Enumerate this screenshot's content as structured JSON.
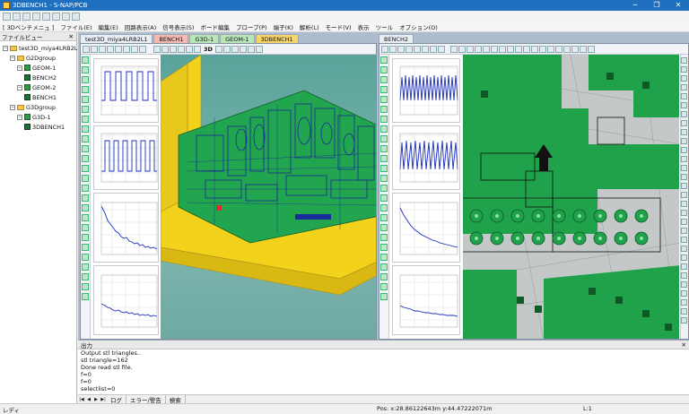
{
  "window": {
    "title": "3DBENCH1 - S-NAP/PCB",
    "minimize": "─",
    "maximize": "❐",
    "close": "✕"
  },
  "menubar": {
    "items": [
      "[ 3Dベンチメニュ ]",
      "ファイル(E)",
      "編集(E)",
      "回路表示(A)",
      "信号表示(S)",
      "ボード編集",
      "プローブ(P)",
      "端子(K)",
      "解析(L)",
      "モード(V)",
      "表示",
      "ツール",
      "オプション(O)"
    ]
  },
  "sidebar": {
    "title": "ファイルビュー",
    "close": "✕",
    "tree": [
      {
        "label": "test3D_miya4LRB2L1",
        "level": 0,
        "expander": "−",
        "icon": "folder"
      },
      {
        "label": "G2Dgroup",
        "level": 1,
        "expander": "−",
        "icon": "folder"
      },
      {
        "label": "GEOM-1",
        "level": 2,
        "expander": "−",
        "icon": "geo"
      },
      {
        "label": "BENCH2",
        "level": 3,
        "expander": "",
        "icon": "bench"
      },
      {
        "label": "GEOM-2",
        "level": 2,
        "expander": "−",
        "icon": "geo"
      },
      {
        "label": "BENCH1",
        "level": 3,
        "expander": "",
        "icon": "bench"
      },
      {
        "label": "G3Dgroup",
        "level": 1,
        "expander": "−",
        "icon": "folder"
      },
      {
        "label": "G3D-1",
        "level": 2,
        "expander": "−",
        "icon": "geo"
      },
      {
        "label": "3DBENCH1",
        "level": 3,
        "expander": "",
        "icon": "bench"
      }
    ]
  },
  "left_tabs": [
    {
      "label": "test3D_miya4LRB2L1",
      "color": "#e9eef5"
    },
    {
      "label": "BENCH1",
      "color": "#f6b8b0"
    },
    {
      "label": "G3D-1",
      "color": "#b9e6b9"
    },
    {
      "label": "GEOM-1",
      "color": "#b9e6b9"
    },
    {
      "label": "3DBENCH1",
      "color": "#f7d56a"
    }
  ],
  "right_tabs": [
    {
      "label": "BENCH2",
      "color": "#e9eef5"
    }
  ],
  "left_pane": {
    "toolbar_text": "3D",
    "graphs": 4
  },
  "output": {
    "title": "出力",
    "close": "✕",
    "lines": [
      "Output stl triangles..",
      "stl triangle=162",
      "Done read stl file.",
      "f=0",
      "f=0",
      "selectlist=0"
    ],
    "tabs": [
      "ログ",
      "エラー/警告",
      "検索"
    ]
  },
  "statusbar": {
    "ready": "レディ",
    "position": "Pos: x:28.86122643m y:44.47222071m",
    "layer": "L:1"
  },
  "colors": {
    "titlebar": "#1e6fc0",
    "pcb_green": "#1fa24a",
    "trace_blue": "#1a2a9a",
    "board_yellow": "#f2d21a"
  }
}
